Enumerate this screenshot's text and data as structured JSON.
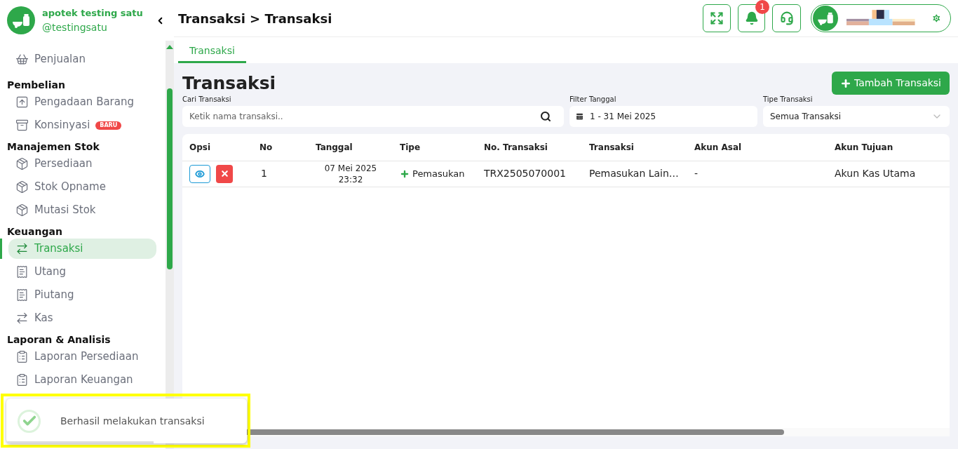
{
  "store": {
    "name": "apotek testing satu",
    "handle": "@testingsatu"
  },
  "sidebar": {
    "top_items": [
      {
        "label": "Penjualan",
        "selected": false
      }
    ],
    "groups": [
      {
        "title": "Pembelian",
        "items": [
          {
            "label": "Pengadaan Barang",
            "selected": false
          },
          {
            "label": "Konsinyasi",
            "selected": false,
            "badge": "BARU"
          }
        ]
      },
      {
        "title": "Manajemen Stok",
        "items": [
          {
            "label": "Persediaan",
            "selected": false
          },
          {
            "label": "Stok Opname",
            "selected": false
          },
          {
            "label": "Mutasi Stok",
            "selected": false
          }
        ]
      },
      {
        "title": "Keuangan",
        "items": [
          {
            "label": "Transaksi",
            "selected": true
          },
          {
            "label": "Utang",
            "selected": false
          },
          {
            "label": "Piutang",
            "selected": false
          },
          {
            "label": "Kas",
            "selected": false
          }
        ]
      },
      {
        "title": "Laporan & Analisis",
        "items": [
          {
            "label": "Laporan Persediaan",
            "selected": false
          },
          {
            "label": "Laporan Keuangan",
            "selected": false
          }
        ]
      }
    ]
  },
  "breadcrumb": "Transaksi > Transaksi",
  "notification_count": "1",
  "tabs": [
    {
      "label": "Transaksi",
      "selected": true
    }
  ],
  "page_title": "Transaksi",
  "add_button": "Tambah Transaksi",
  "filters": {
    "search": {
      "label": "Cari Transaksi",
      "placeholder": "Ketik nama transaksi.."
    },
    "date": {
      "label": "Filter Tanggal",
      "value": "1 - 31 Mei 2025"
    },
    "type": {
      "label": "Tipe Transaksi",
      "value": "Semua Transaksi"
    }
  },
  "table": {
    "columns": [
      "Opsi",
      "No",
      "Tanggal",
      "Tipe",
      "No. Transaksi",
      "Transaksi",
      "Akun Asal",
      "Akun Tujuan"
    ],
    "rows": [
      {
        "no": "1",
        "date": "07 Mei 2025",
        "time": "23:32",
        "type": "Pemasukan",
        "number": "TRX2505070001",
        "transaction": "Pemasukan Lain…",
        "from": "-",
        "to": "Akun Kas Utama"
      }
    ]
  },
  "toast": {
    "message": "Berhasil melakukan transaksi"
  }
}
